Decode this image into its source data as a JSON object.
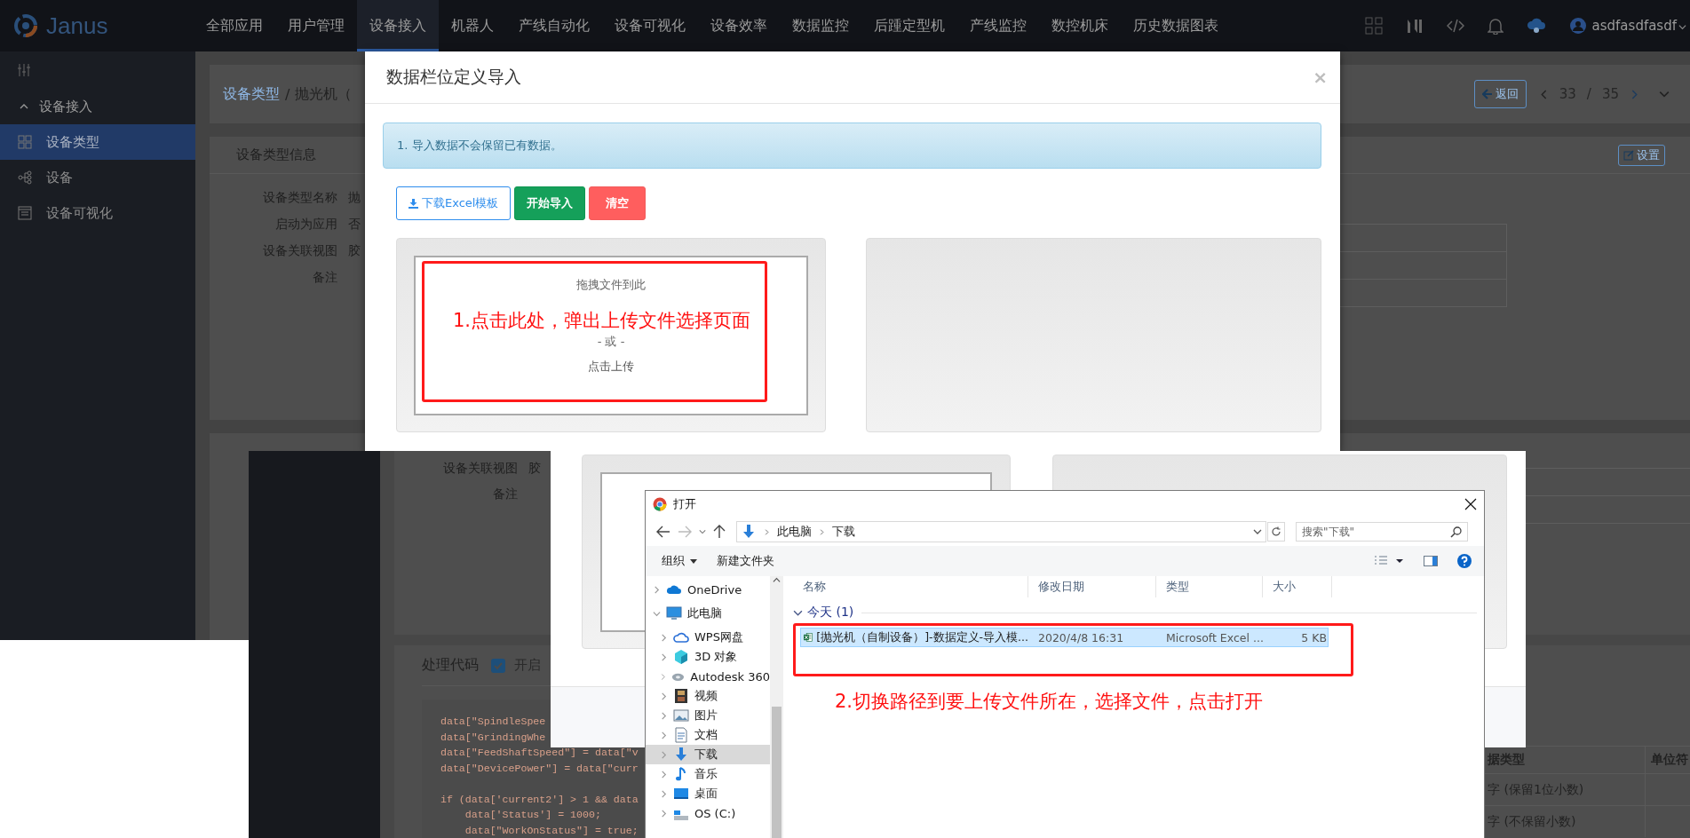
{
  "app": {
    "logo": "Janus",
    "nav": [
      {
        "label": "全部应用",
        "selected": false
      },
      {
        "label": "用户管理",
        "selected": false
      },
      {
        "label": "设备接入",
        "selected": true
      },
      {
        "label": "机器人",
        "selected": false
      },
      {
        "label": "产线自动化",
        "selected": false
      },
      {
        "label": "设备可视化",
        "selected": false
      },
      {
        "label": "设备效率",
        "selected": false
      },
      {
        "label": "数据监控",
        "selected": false
      },
      {
        "label": "后踵定型机",
        "selected": false
      },
      {
        "label": "产线监控",
        "selected": false
      },
      {
        "label": "数控机床",
        "selected": false
      },
      {
        "label": "历史数据图表",
        "selected": false
      }
    ],
    "user": "asdfasdfasdf",
    "sidebar": {
      "group": "设备接入",
      "expanded": true,
      "items": [
        {
          "label": "设备类型",
          "kind": "grid",
          "selected": true
        },
        {
          "label": "设备",
          "kind": "tree",
          "selected": false
        },
        {
          "label": "设备可视化",
          "kind": "window",
          "selected": false
        }
      ]
    },
    "breadcrumb": {
      "root": "设备类型",
      "separator": "/",
      "current": "抛光机（"
    },
    "back_button": "返回",
    "page": "33",
    "page_separator": "/",
    "page_total": "35",
    "info_card": {
      "title": "设备类型信息",
      "settings_button": "设置",
      "fields": [
        {
          "label": "设备类型名称",
          "value": "抛"
        },
        {
          "label": "启动为应用",
          "value": "否"
        },
        {
          "label": "设备关联视图",
          "value": "胶"
        },
        {
          "label": "备注"
        }
      ]
    }
  },
  "import_dialog": {
    "title": "数据栏位定义导入",
    "close": "×",
    "notice": "1. 导入数据不会保留已有数据。",
    "buttons": [
      {
        "label": "下载Excel模板",
        "kind": "download"
      },
      {
        "label": "开始导入",
        "kind": "primary"
      },
      {
        "label": "清空",
        "kind": "danger"
      }
    ],
    "dropzone": {
      "hint": "拖拽文件到此",
      "or": "- 或 -",
      "action": "点击上传"
    }
  },
  "annotation_1": "1.点击此处，弹出上传文件选择页面",
  "second_capture": {
    "fields": [
      {
        "label": "设备关联视图",
        "value": "胶"
      },
      {
        "label": "备注"
      }
    ],
    "code_section": {
      "title": "处理代码",
      "enabled": true,
      "enabled_label": "开启",
      "code_paragraphs": [
        [
          "data[\"SpindleSpee",
          "data[\"GrindingWhe",
          "data[\"FeedShaftSpeed\"] = data[\"v",
          "data[\"DevicePower\"] = data[\"curr"
        ],
        [
          "if (data['current2'] > 1 && data",
          "    data['Status'] = 1000;",
          "    data[\"WorkOnStatus\"] = true;"
        ]
      ]
    },
    "table": {
      "columns": [
        "据类型",
        "单位符"
      ],
      "rows": [
        [
          "字 (保留1位小数)"
        ],
        [
          "字 (不保留小数)"
        ]
      ]
    }
  },
  "open_dialog": {
    "title": "打开",
    "path": [
      "此电脑",
      "下载"
    ],
    "search_placeholder": "搜索\"下载\"",
    "toolbar": [
      {
        "label": "组织",
        "kind": "menu"
      },
      {
        "label": "新建文件夹",
        "kind": "plain"
      }
    ],
    "nav": [
      {
        "label": "OneDrive",
        "kind": "cloud",
        "expanded": false,
        "selected": false
      },
      {
        "label": "此电脑",
        "kind": "pc",
        "expanded": true,
        "selected": false,
        "children": [
          {
            "label": "WPS网盘",
            "kind": "wps",
            "expanded": false,
            "selected": false
          },
          {
            "label": "3D 对象",
            "kind": "cube",
            "expanded": false,
            "selected": false
          },
          {
            "label": "Autodesk 360",
            "kind": "disc",
            "expanded": false,
            "selected": false
          },
          {
            "label": "视频",
            "kind": "film",
            "expanded": false,
            "selected": false
          },
          {
            "label": "图片",
            "kind": "image",
            "expanded": false,
            "selected": false
          },
          {
            "label": "文档",
            "kind": "doc",
            "expanded": false,
            "selected": false
          },
          {
            "label": "下载",
            "kind": "download",
            "expanded": false,
            "selected": true
          },
          {
            "label": "音乐",
            "kind": "music",
            "expanded": false,
            "selected": false
          },
          {
            "label": "桌面",
            "kind": "desktop",
            "expanded": false,
            "selected": false
          },
          {
            "label": "OS (C:)",
            "kind": "drive",
            "expanded": false,
            "selected": false
          }
        ]
      }
    ],
    "columns": [
      "名称",
      "修改日期",
      "类型",
      "大小"
    ],
    "group": {
      "label": "今天 (1)",
      "expanded": true
    },
    "files": [
      {
        "name": "[抛光机（自制设备）]-数据定义-导入模...",
        "date": "2020/4/8 16:31",
        "type": "Microsoft Excel ...",
        "size": "5 KB",
        "selected": true
      }
    ]
  },
  "annotation_2": "2.切换路径到要上传文件所在，选择文件，点击打开"
}
